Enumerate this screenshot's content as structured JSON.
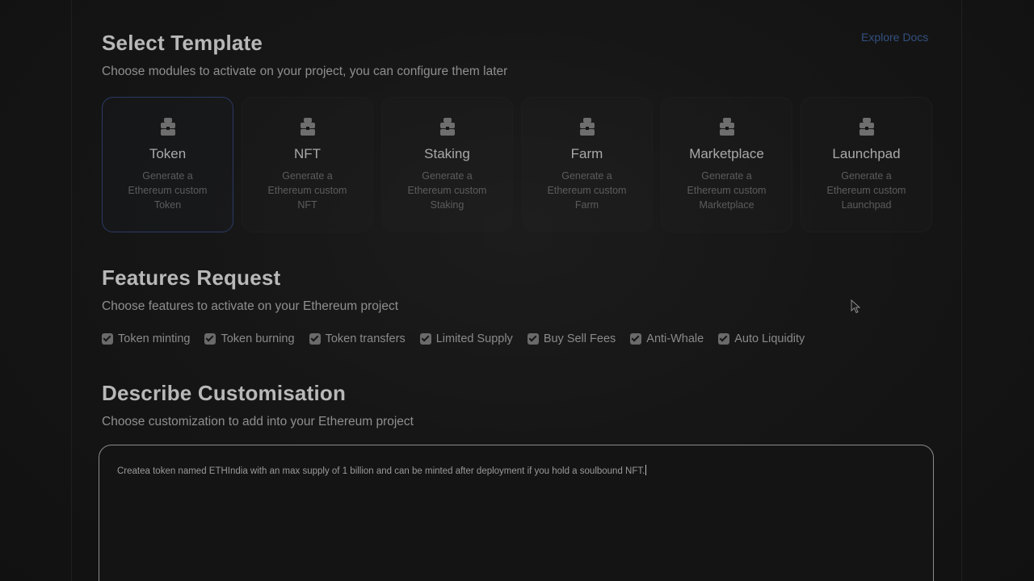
{
  "header": {
    "title": "Select Template",
    "subtitle": "Choose modules to activate on your project, you can configure them later",
    "explore_link": "Explore Docs"
  },
  "templates": [
    {
      "title": "Token",
      "description": "Generate a Ethereum custom Token",
      "selected": true,
      "icon": "toolbox-icon"
    },
    {
      "title": "NFT",
      "description": "Generate a Ethereum custom NFT",
      "selected": false,
      "icon": "toolbox-icon"
    },
    {
      "title": "Staking",
      "description": "Generate a Ethereum custom Staking",
      "selected": false,
      "icon": "toolbox-icon"
    },
    {
      "title": "Farm",
      "description": "Generate a Ethereum custom Farm",
      "selected": false,
      "icon": "toolbox-icon"
    },
    {
      "title": "Marketplace",
      "description": "Generate a Ethereum custom Marketplace",
      "selected": false,
      "icon": "toolbox-icon"
    },
    {
      "title": "Launchpad",
      "description": "Generate a Ethereum custom Launchpad",
      "selected": false,
      "icon": "toolbox-icon"
    }
  ],
  "features": {
    "title": "Features Request",
    "subtitle": "Choose features to activate on your Ethereum project",
    "items": [
      {
        "label": "Token minting",
        "checked": true
      },
      {
        "label": "Token burning",
        "checked": true
      },
      {
        "label": "Token transfers",
        "checked": true
      },
      {
        "label": "Limited Supply",
        "checked": true
      },
      {
        "label": "Buy Sell Fees",
        "checked": true
      },
      {
        "label": "Anti-Whale",
        "checked": true
      },
      {
        "label": "Auto Liquidity",
        "checked": true
      }
    ]
  },
  "customisation": {
    "title": "Describe Customisation",
    "subtitle": "Choose customization to add into your Ethereum project",
    "input_value": "Createa token named ETHIndia with an max supply of 1 billion and can be minted after deployment if you hold a soulbound NFT."
  },
  "colors": {
    "background": "#131313",
    "selected_border": "#2b3a66",
    "link": "#33507f"
  }
}
